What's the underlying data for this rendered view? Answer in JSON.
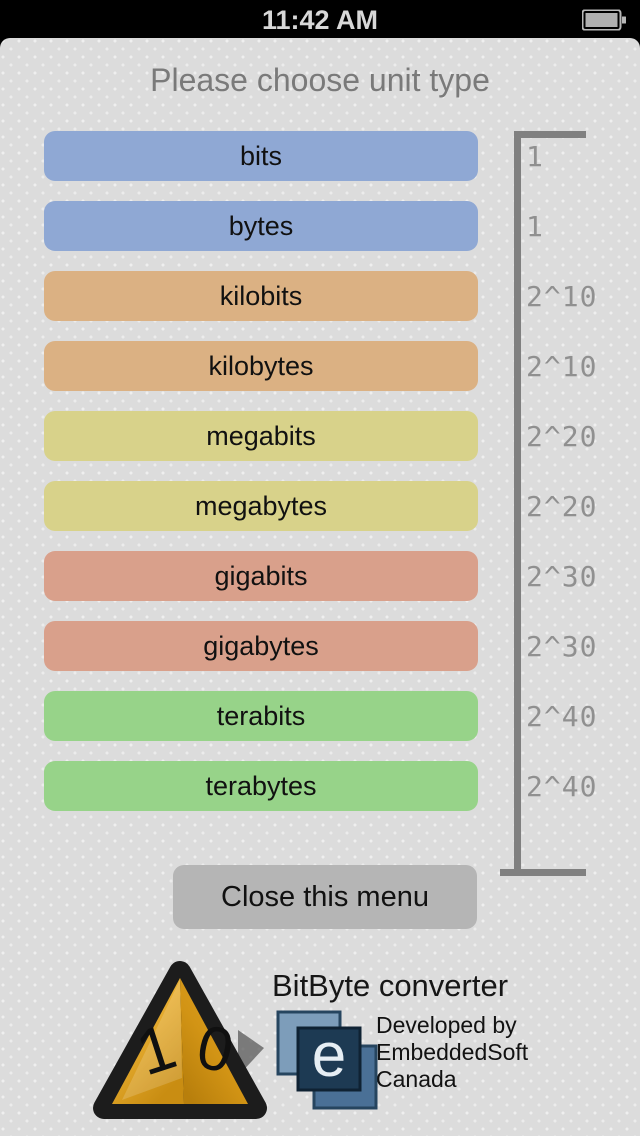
{
  "status_bar": {
    "time": "11:42 AM",
    "battery_icon": "battery-icon"
  },
  "header": {
    "title": "Please choose unit type"
  },
  "units": [
    {
      "label": "bits",
      "exponent": "1",
      "color": "#8fa8d4"
    },
    {
      "label": "bytes",
      "exponent": "1",
      "color": "#8fa8d4"
    },
    {
      "label": "kilobits",
      "exponent": "2^10",
      "color": "#dbb183"
    },
    {
      "label": "kilobytes",
      "exponent": "2^10",
      "color": "#dbb183"
    },
    {
      "label": "megabits",
      "exponent": "2^20",
      "color": "#d8d28a"
    },
    {
      "label": "megabytes",
      "exponent": "2^20",
      "color": "#d8d28a"
    },
    {
      "label": "gigabits",
      "exponent": "2^30",
      "color": "#d9a08b"
    },
    {
      "label": "gigabytes",
      "exponent": "2^30",
      "color": "#d9a08b"
    },
    {
      "label": "terabits",
      "exponent": "2^40",
      "color": "#97d389"
    },
    {
      "label": "terabytes",
      "exponent": "2^40",
      "color": "#97d389"
    }
  ],
  "close_button": {
    "label": "Close this menu"
  },
  "footer": {
    "pyramid_logo": {
      "icon": "pyramid-logo-icon",
      "left_face_digit": "1",
      "right_face_digit": "0"
    },
    "brand_title": "BitByte converter",
    "e_logo": {
      "icon": "embeddedsoft-e-logo-icon",
      "letter": "e"
    },
    "developer_lines": [
      "Developed by",
      "EmbeddedSoft",
      "Canada"
    ]
  },
  "colors": {
    "panel_background": "#dcdcdc",
    "status_bar_background": "#000000",
    "bracket": "#808080",
    "exponent_text": "#909090",
    "title_text": "#7a7a7a",
    "close_button": "#b5b5b5"
  }
}
